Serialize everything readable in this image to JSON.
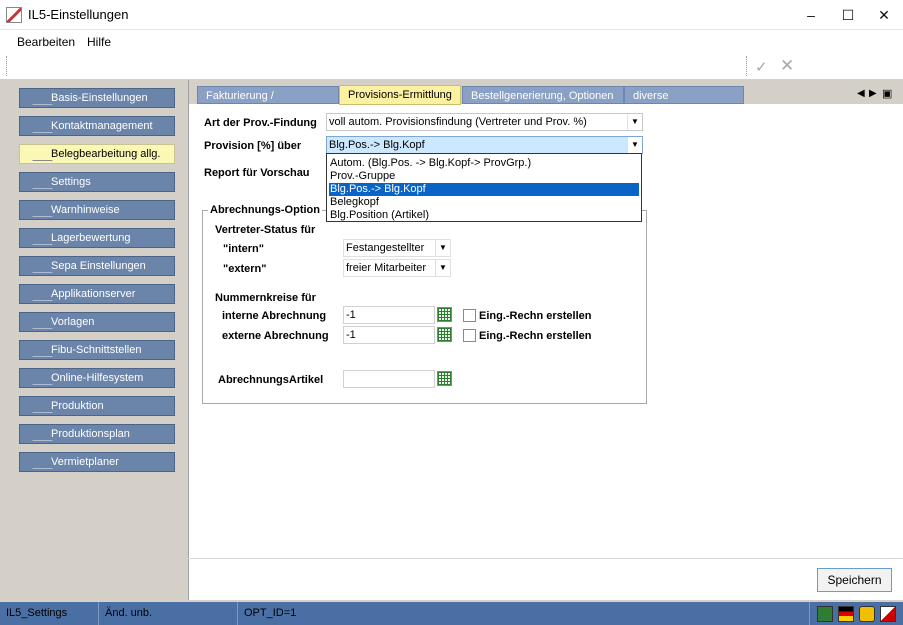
{
  "window": {
    "title": "IL5-Einstellungen",
    "minimize": "–",
    "maximize": "☐",
    "close": "✕"
  },
  "menu": {
    "items": [
      "Bearbeiten",
      "Hilfe"
    ]
  },
  "toolbar": {
    "ok_glyph": "✓",
    "cancel_glyph": "✕"
  },
  "sidebar": {
    "items": [
      {
        "label": "Basis-Einstellungen",
        "active": false
      },
      {
        "label": "Kontaktmanagement",
        "active": false
      },
      {
        "label": "Belegbearbeitung allg.",
        "active": true
      },
      {
        "label": "Settings",
        "active": false
      },
      {
        "label": "Warnhinweise",
        "active": false
      },
      {
        "label": "Lagerbewertung",
        "active": false
      },
      {
        "label": "Sepa Einstellungen",
        "active": false
      },
      {
        "label": "Applikationserver",
        "active": false
      },
      {
        "label": "Vorlagen",
        "active": false
      },
      {
        "label": "Fibu-Schnittstellen",
        "active": false
      },
      {
        "label": "Online-Hilfesystem",
        "active": false
      },
      {
        "label": "Produktion",
        "active": false
      },
      {
        "label": "Produktionsplan",
        "active": false
      },
      {
        "label": "Vermietplaner",
        "active": false
      }
    ]
  },
  "tabs": {
    "items": [
      {
        "label": "Fakturierung / Sammelrg.",
        "active": false
      },
      {
        "label": "Provisions-Ermittlung",
        "active": true
      },
      {
        "label": "Bestellgenerierung, Optionen",
        "active": false
      },
      {
        "label": "diverse Einstellungen",
        "active": false
      }
    ],
    "prev": "◀",
    "next": "▶",
    "menu": "▣"
  },
  "form": {
    "art_label": "Art der Prov.-Findung",
    "art_value": "voll autom. Provisionsfindung (Vertreter und Prov. %)",
    "prov_label": "Provision [%] über",
    "prov_value": "Blg.Pos.-> Blg.Kopf",
    "report_label": "Report für Vorschau",
    "dropdown_arrow": "▼",
    "dropdown_options": [
      {
        "label": "Autom. (Blg.Pos. -> Blg.Kopf-> ProvGrp.)",
        "selected": false
      },
      {
        "label": "Prov.-Gruppe",
        "selected": false
      },
      {
        "label": "Blg.Pos.-> Blg.Kopf",
        "selected": true
      },
      {
        "label": "Belegkopf",
        "selected": false
      },
      {
        "label": "Blg.Position (Artikel)",
        "selected": false
      }
    ],
    "group": {
      "title": "Abrechnungs-Option",
      "vertreter_label": "Vertreter-Status für",
      "intern_label": "\"intern\"",
      "intern_value": "Festangestellter",
      "extern_label": "\"extern\"",
      "extern_value": "freier Mitarbeiter",
      "nummern_label": "Nummernkreise für",
      "interne_label": "interne Abrechnung",
      "interne_value": "-1",
      "externe_label": "externe Abrechnung",
      "externe_value": "-1",
      "eing_label_1": "Eing.-Rechn erstellen",
      "eing_label_2": "Eing.-Rechn erstellen",
      "artikel_label": "AbrechnungsArtikel",
      "artikel_value": ""
    }
  },
  "footer": {
    "save_label": "Speichern"
  },
  "statusbar": {
    "cell1": "IL5_Settings",
    "cell2": "Änd. unb.",
    "cell3": "OPT_ID=1"
  },
  "colors": {
    "nav_blue": "#6b84aa",
    "nav_active": "#fbf7b4",
    "tab_active": "#fbf1a0",
    "status_blue": "#4a6fa5",
    "selection": "#0a64c8"
  }
}
